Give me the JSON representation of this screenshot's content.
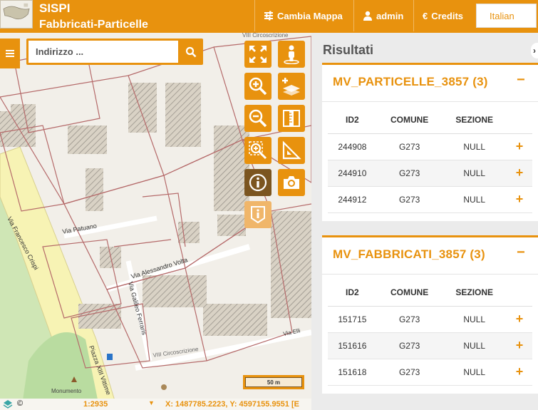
{
  "header": {
    "title": "SISPI",
    "subtitle": "Fabbricati-Particelle",
    "change_map": "Cambia Mappa",
    "user": "admin",
    "credits": "Credits",
    "language": "Italian"
  },
  "map": {
    "search_placeholder": "Indirizzo ...",
    "scale_text": "50 m",
    "scale_ratio": "1:2935",
    "coordinates": "X: 1487785.2223, Y: 4597155.9551",
    "coord_suffix": "[E",
    "copyright": "©",
    "street_labels": [
      "Via Francesco Crispi",
      "Via Patuano",
      "Via Alessandro Volta",
      "Via Galileo Ferraris",
      "Piazza XIII Vittime",
      "VIII Circoscrizione",
      "VIII Circoscrizione",
      "Monumento",
      "Via Elli"
    ],
    "tools": [
      "fullscreen-icon",
      "street-view-icon",
      "zoom-in-icon",
      "add-layer-icon",
      "zoom-out-icon",
      "measure-ruler-icon",
      "zoom-area-icon",
      "measure-area-icon",
      "info-icon",
      "camera-icon",
      "info-multi-icon"
    ]
  },
  "results": {
    "title": "Risultati",
    "panels": [
      {
        "title": "MV_PARTICELLE_3857 (3)",
        "collapse": "−",
        "columns": [
          "ID2",
          "COMUNE",
          "SEZIONE"
        ],
        "rows": [
          [
            "244908",
            "G273",
            "NULL"
          ],
          [
            "244910",
            "G273",
            "NULL"
          ],
          [
            "244912",
            "G273",
            "NULL"
          ]
        ]
      },
      {
        "title": "MV_FABBRICATI_3857 (3)",
        "collapse": "−",
        "columns": [
          "ID2",
          "COMUNE",
          "SEZIONE"
        ],
        "rows": [
          [
            "151715",
            "G273",
            "NULL"
          ],
          [
            "151616",
            "G273",
            "NULL"
          ],
          [
            "151618",
            "G273",
            "NULL"
          ]
        ]
      }
    ]
  },
  "colors": {
    "accent": "#e8920e",
    "accent_dark": "#7b5520",
    "parcel_line": "#b56a6a"
  }
}
